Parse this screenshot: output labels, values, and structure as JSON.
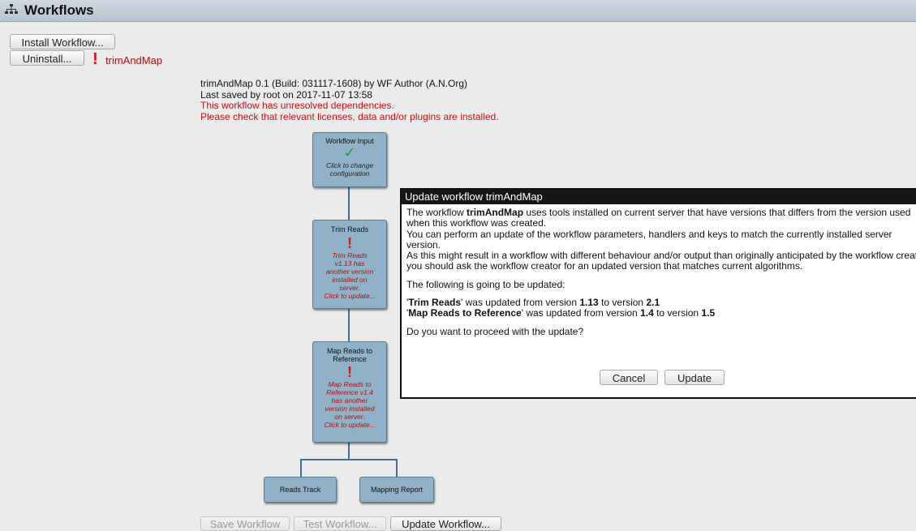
{
  "window": {
    "title": "Workflows",
    "icon": "workflow-tree-icon"
  },
  "toolbar": {
    "install_label": "Install Workflow...",
    "uninstall_label": "Uninstall..."
  },
  "workflow_list": {
    "error_mark": "!",
    "selected_name": "trimAndMap"
  },
  "details": {
    "version_line": "trimAndMap 0.1 (Build: 031117-1608) by WF Author (A.N.Org)",
    "saved_line": "Last saved by root on 2017-11-07 13:58",
    "warning_1": "This workflow has unresolved dependencies.",
    "warning_2": "Please check that relevant licenses, data and/or plugins are installed."
  },
  "graph": {
    "input_node": {
      "title": "Workflow Input",
      "status": "✓",
      "sub_1": "Click to change",
      "sub_2": "configuration"
    },
    "trim_node": {
      "title": "Trim Reads",
      "mark": "!",
      "sub": [
        "Trim Reads",
        "v1.13 has",
        "another version",
        "installed on",
        "server.",
        "Click to update..."
      ]
    },
    "map_node": {
      "title_1": "Map Reads to",
      "title_2": "Reference",
      "mark": "!",
      "sub": [
        "Map Reads to",
        "Reference v1.4",
        "has another",
        "version installed",
        "on server.",
        "Click to update..."
      ]
    },
    "reads_track": "Reads Track",
    "mapping_report": "Mapping Report"
  },
  "dialog": {
    "title": "Update workflow trimAndMap",
    "p1_pre": "The workflow ",
    "p1_bold": "trimAndMap",
    "p1_post": " uses tools installed on current server that have versions that differs from the version used",
    "p1_line2": "when this workflow was created.",
    "p2_line1": "You can perform an update of the workflow parameters, handlers and keys to match the currently installed server",
    "p2_line2": "version.",
    "p3_line1": "As this might result in a workflow with different behaviour and/or output than originally anticipated by the workflow creator",
    "p3_line2": "you should ask the workflow creator for an updated version that matches current algorithms.",
    "p4": "The following is going to be updated:",
    "u1_name": "Trim Reads",
    "u1_text": "' was updated from version ",
    "u1_from": "1.13",
    "u1_to_text": " to version ",
    "u1_to": "2.1",
    "u2_name": "Map Reads to Reference",
    "u2_text": "' was updated from version ",
    "u2_from": "1.4",
    "u2_to_text": " to version ",
    "u2_to": "1.5",
    "quote": "'",
    "question": "Do you want to proceed with the update?",
    "cancel_label": "Cancel",
    "update_label": "Update"
  },
  "bottom": {
    "save_label": "Save Workflow",
    "test_label": "Test Workflow...",
    "update_label": "Update Workflow..."
  }
}
